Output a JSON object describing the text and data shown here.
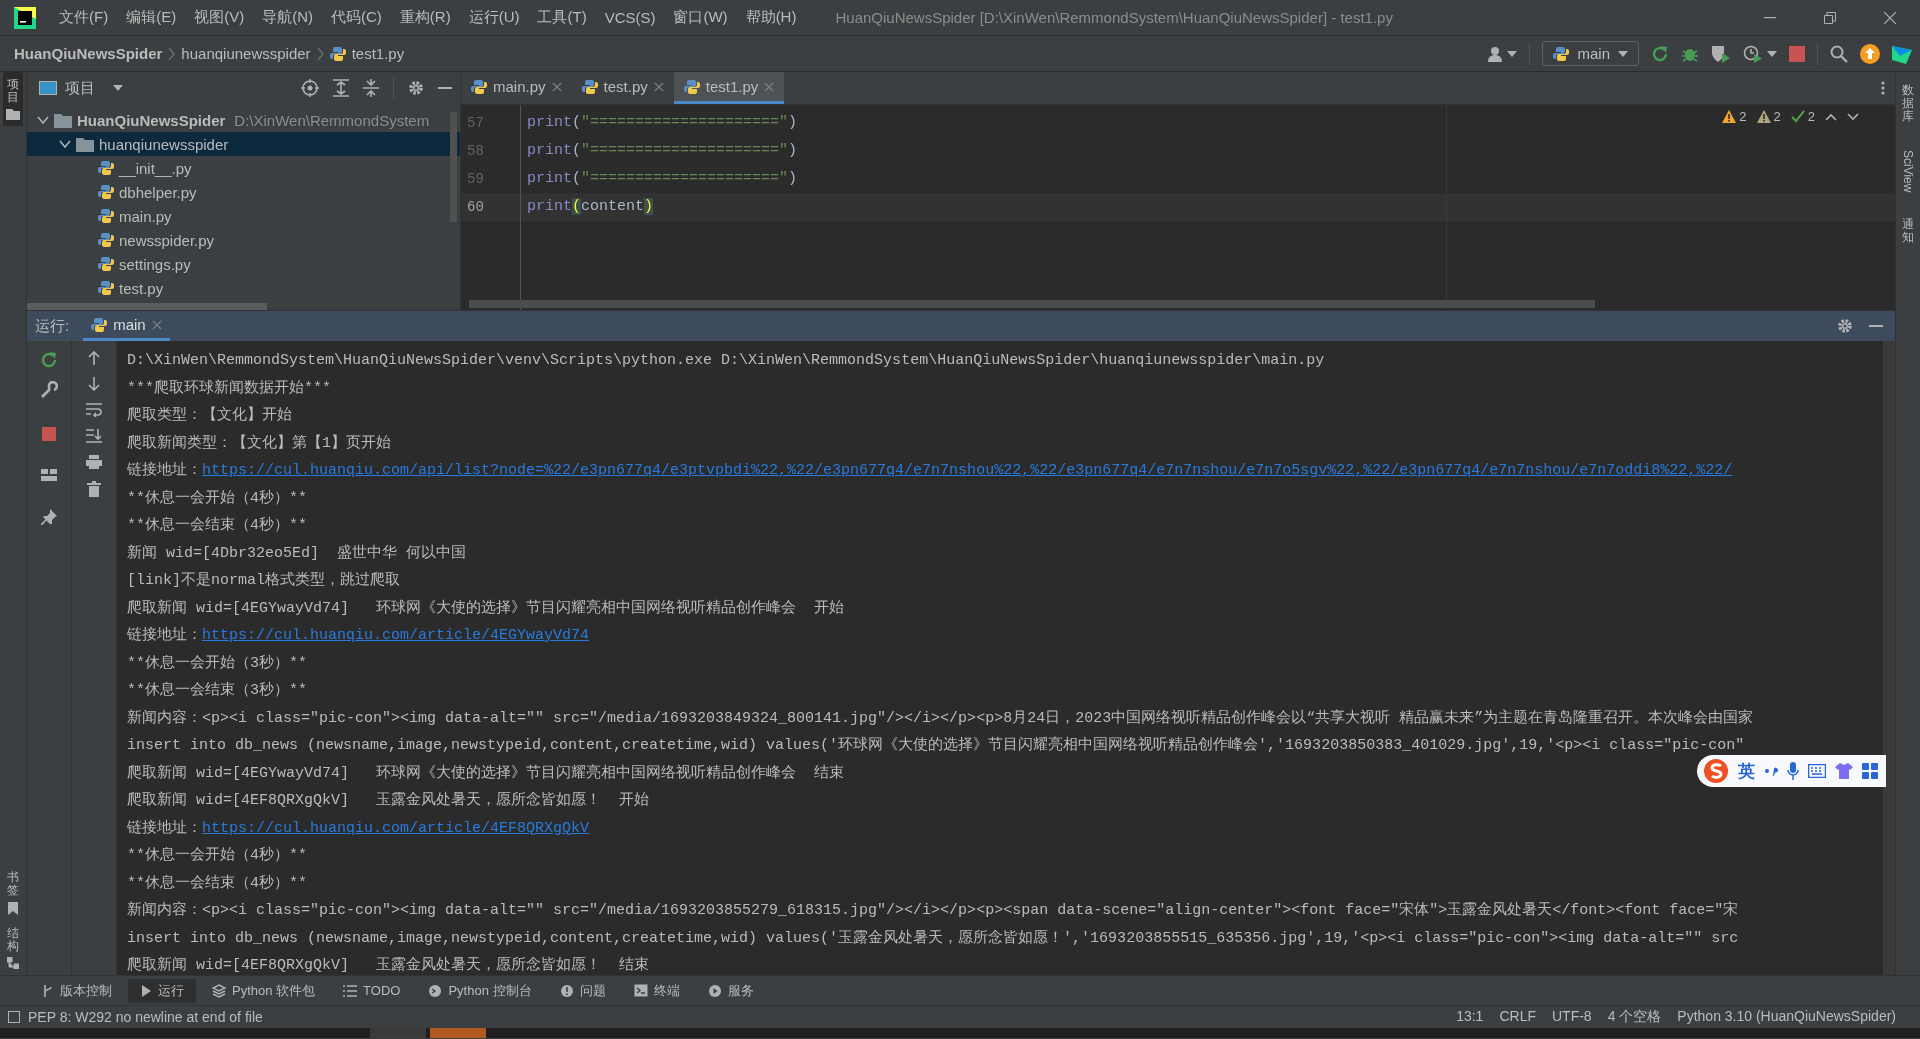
{
  "menu_bar": {
    "items": [
      "文件(F)",
      "编辑(E)",
      "视图(V)",
      "导航(N)",
      "代码(C)",
      "重构(R)",
      "运行(U)",
      "工具(T)",
      "VCS(S)",
      "窗口(W)",
      "帮助(H)"
    ],
    "title": "HuanQiuNewsSpider [D:\\XinWen\\RemmondSystem\\HuanQiuNewsSpider] - test1.py"
  },
  "breadcrumb": [
    "HuanQiuNewsSpider",
    "huanqiunewsspider",
    "test1.py"
  ],
  "run_config": {
    "label": "main"
  },
  "left_stripe": {
    "top": [
      {
        "label": "项目",
        "selected": true
      }
    ],
    "bottom": [
      {
        "label": "书签",
        "selected": false
      },
      {
        "label": "结构",
        "selected": false
      }
    ]
  },
  "right_stripe": [
    {
      "label": "数据库",
      "kind": "stacked"
    },
    {
      "label": "SciView",
      "kind": "rotated"
    },
    {
      "label": "通知",
      "kind": "stacked"
    }
  ],
  "project": {
    "title": "项目",
    "tree": [
      {
        "label": "HuanQiuNewsSpider",
        "path": "D:\\XinWen\\RemmondSystem",
        "expanded": true,
        "selected": false,
        "children": [
          {
            "label": "huanqiunewsspider",
            "expanded": true,
            "selected": true,
            "children": [
              {
                "label": "__init__.py",
                "selected": false
              },
              {
                "label": "dbhelper.py",
                "selected": false
              },
              {
                "label": "main.py",
                "selected": false
              },
              {
                "label": "newsspider.py",
                "selected": false
              },
              {
                "label": "settings.py",
                "selected": false
              },
              {
                "label": "test.py",
                "selected": false
              }
            ]
          }
        ]
      }
    ]
  },
  "editor": {
    "tabs": [
      {
        "label": "main.py",
        "selected": false
      },
      {
        "label": "test.py",
        "selected": false
      },
      {
        "label": "test1.py",
        "selected": true
      }
    ],
    "inspections": [
      {
        "kind": "warning",
        "count": "2"
      },
      {
        "kind": "weak",
        "count": "2"
      },
      {
        "kind": "typo",
        "count": "2"
      }
    ],
    "lines": [
      {
        "number": "57",
        "current": false,
        "tokens": [
          {
            "text": "print",
            "kind": "builtin"
          },
          {
            "text": "(",
            "kind": "paren"
          },
          {
            "text": "\"=====================\"",
            "kind": "string"
          },
          {
            "text": ")",
            "kind": "paren"
          }
        ]
      },
      {
        "number": "58",
        "current": false,
        "tokens": [
          {
            "text": "print",
            "kind": "builtin"
          },
          {
            "text": "(",
            "kind": "paren"
          },
          {
            "text": "\"=====================\"",
            "kind": "string"
          },
          {
            "text": ")",
            "kind": "paren"
          }
        ]
      },
      {
        "number": "59",
        "current": false,
        "tokens": [
          {
            "text": "print",
            "kind": "builtin"
          },
          {
            "text": "(",
            "kind": "paren"
          },
          {
            "text": "\"=====================\"",
            "kind": "string"
          },
          {
            "text": ")",
            "kind": "paren"
          }
        ]
      },
      {
        "number": "60",
        "current": true,
        "tokens": [
          {
            "text": "print",
            "kind": "builtin"
          },
          {
            "text": "(",
            "kind": "match"
          },
          {
            "text": "content",
            "kind": "ident"
          },
          {
            "text": ")",
            "kind": "match"
          }
        ]
      }
    ]
  },
  "run_panel": {
    "label": "运行:",
    "tabs": [
      {
        "label": "main",
        "selected": true
      }
    ],
    "lines": [
      {
        "text": "D:\\XinWen\\RemmondSystem\\HuanQiuNewsSpider\\venv\\Scripts\\python.exe D:\\XinWen\\RemmondSystem\\HuanQiuNewsSpider\\huanqiunewsspider\\main.py"
      },
      {
        "text": "***爬取环球新闻数据开始***"
      },
      {
        "text": "爬取类型：【文化】开始"
      },
      {
        "text": "爬取新闻类型：【文化】第【1】页开始"
      },
      {
        "text": "链接地址：",
        "link": "https://cul.huanqiu.com/api/list?node=%22/e3pn677q4/e3ptvpbdi%22,%22/e3pn677q4/e7n7nshou%22,%22/e3pn677q4/e7n7nshou/e7n7o5sgv%22,%22/e3pn677q4/e7n7nshou/e7n7oddi8%22,%22/"
      },
      {
        "text": "**休息一会开始（4秒）**"
      },
      {
        "text": "**休息一会结束（4秒）**"
      },
      {
        "text": "新闻 wid=[4Dbr32eo5Ed]  盛世中华 何以中国"
      },
      {
        "text": "[link]不是normal格式类型，跳过爬取"
      },
      {
        "text": "爬取新闻 wid=[4EGYwayVd74]   环球网《大使的选择》节目闪耀亮相中国网络视听精品创作峰会  开始"
      },
      {
        "text": "链接地址：",
        "link": "https://cul.huanqiu.com/article/4EGYwayVd74"
      },
      {
        "text": "**休息一会开始（3秒）**"
      },
      {
        "text": "**休息一会结束（3秒）**"
      },
      {
        "text": "新闻内容：<p><i class=\"pic-con\"><img data-alt=\"\" src=\"/media/1693203849324_800141.jpg\"/></i></p><p>8月24日，2023中国网络视听精品创作峰会以“共享大视听 精品赢未来”为主题在青岛隆重召开。本次峰会由国家"
      },
      {
        "text": "insert into db_news (newsname,image,newstypeid,content,createtime,wid) values('环球网《大使的选择》节目闪耀亮相中国网络视听精品创作峰会','1693203850383_401029.jpg',19,'<p><i class=\"pic-con\""
      },
      {
        "text": "爬取新闻 wid=[4EGYwayVd74]   环球网《大使的选择》节目闪耀亮相中国网络视听精品创作峰会  结束"
      },
      {
        "text": "爬取新闻 wid=[4EF8QRXgQkV]   玉露金风处暑天，愿所念皆如愿！  开始"
      },
      {
        "text": "链接地址：",
        "link": "https://cul.huanqiu.com/article/4EF8QRXgQkV"
      },
      {
        "text": "**休息一会开始（4秒）**"
      },
      {
        "text": "**休息一会结束（4秒）**"
      },
      {
        "text": "新闻内容：<p><i class=\"pic-con\"><img data-alt=\"\" src=\"/media/1693203855279_618315.jpg\"/></i></p><p><span data-scene=\"align-center\"><font face=\"宋体\">玉露金风处暑天</font><font face=\"宋"
      },
      {
        "text": "insert into db_news (newsname,image,newstypeid,content,createtime,wid) values('玉露金风处暑天，愿所念皆如愿！','1693203855515_635356.jpg',19,'<p><i class=\"pic-con\"><img data-alt=\"\" src"
      },
      {
        "text": "爬取新闻 wid=[4EF8QRXgQkV]   玉露金风处暑天，愿所念皆如愿！  结束"
      }
    ]
  },
  "tool_tabs": [
    {
      "label": "版本控制",
      "kind": "vcs",
      "selected": false
    },
    {
      "label": "运行",
      "kind": "run",
      "selected": true
    },
    {
      "label": "Python 软件包",
      "kind": "packages",
      "selected": false
    },
    {
      "label": "TODO",
      "kind": "todo",
      "selected": false
    },
    {
      "label": "Python 控制台",
      "kind": "console",
      "selected": false
    },
    {
      "label": "问题",
      "kind": "problems",
      "selected": false
    },
    {
      "label": "终端",
      "kind": "terminal",
      "selected": false
    },
    {
      "label": "服务",
      "kind": "services",
      "selected": false
    }
  ],
  "status_bar": {
    "message": "PEP 8: W292 no newline at end of file",
    "items": [
      "13:1",
      "CRLF",
      "UTF-8",
      "4 个空格",
      "Python 3.10 (HuanQiuNewsSpider)"
    ]
  },
  "ime_bar": {
    "mode": "英"
  }
}
